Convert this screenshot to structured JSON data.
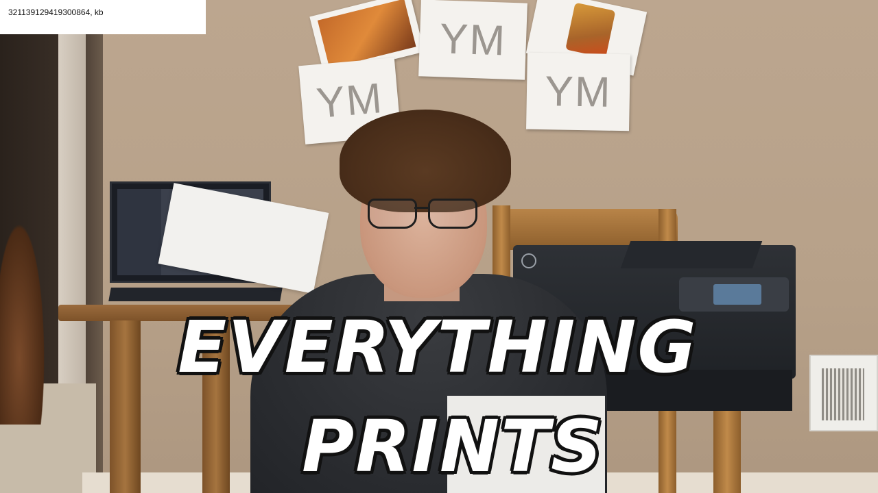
{
  "label": {
    "text": "321139129419300864, kb"
  },
  "posters": {
    "ym_top": "YM",
    "ym_left": "YM",
    "ym_right": "YM"
  },
  "caption": {
    "line1": "EVERYTHING",
    "line2": "PRINTS"
  },
  "colors": {
    "wall": "#bca68f",
    "caption_fill": "#ffffff",
    "caption_outline": "#111111",
    "hoodie": "#2b2d31",
    "printer": "#1f2226",
    "wood": "#8c5e2c"
  }
}
